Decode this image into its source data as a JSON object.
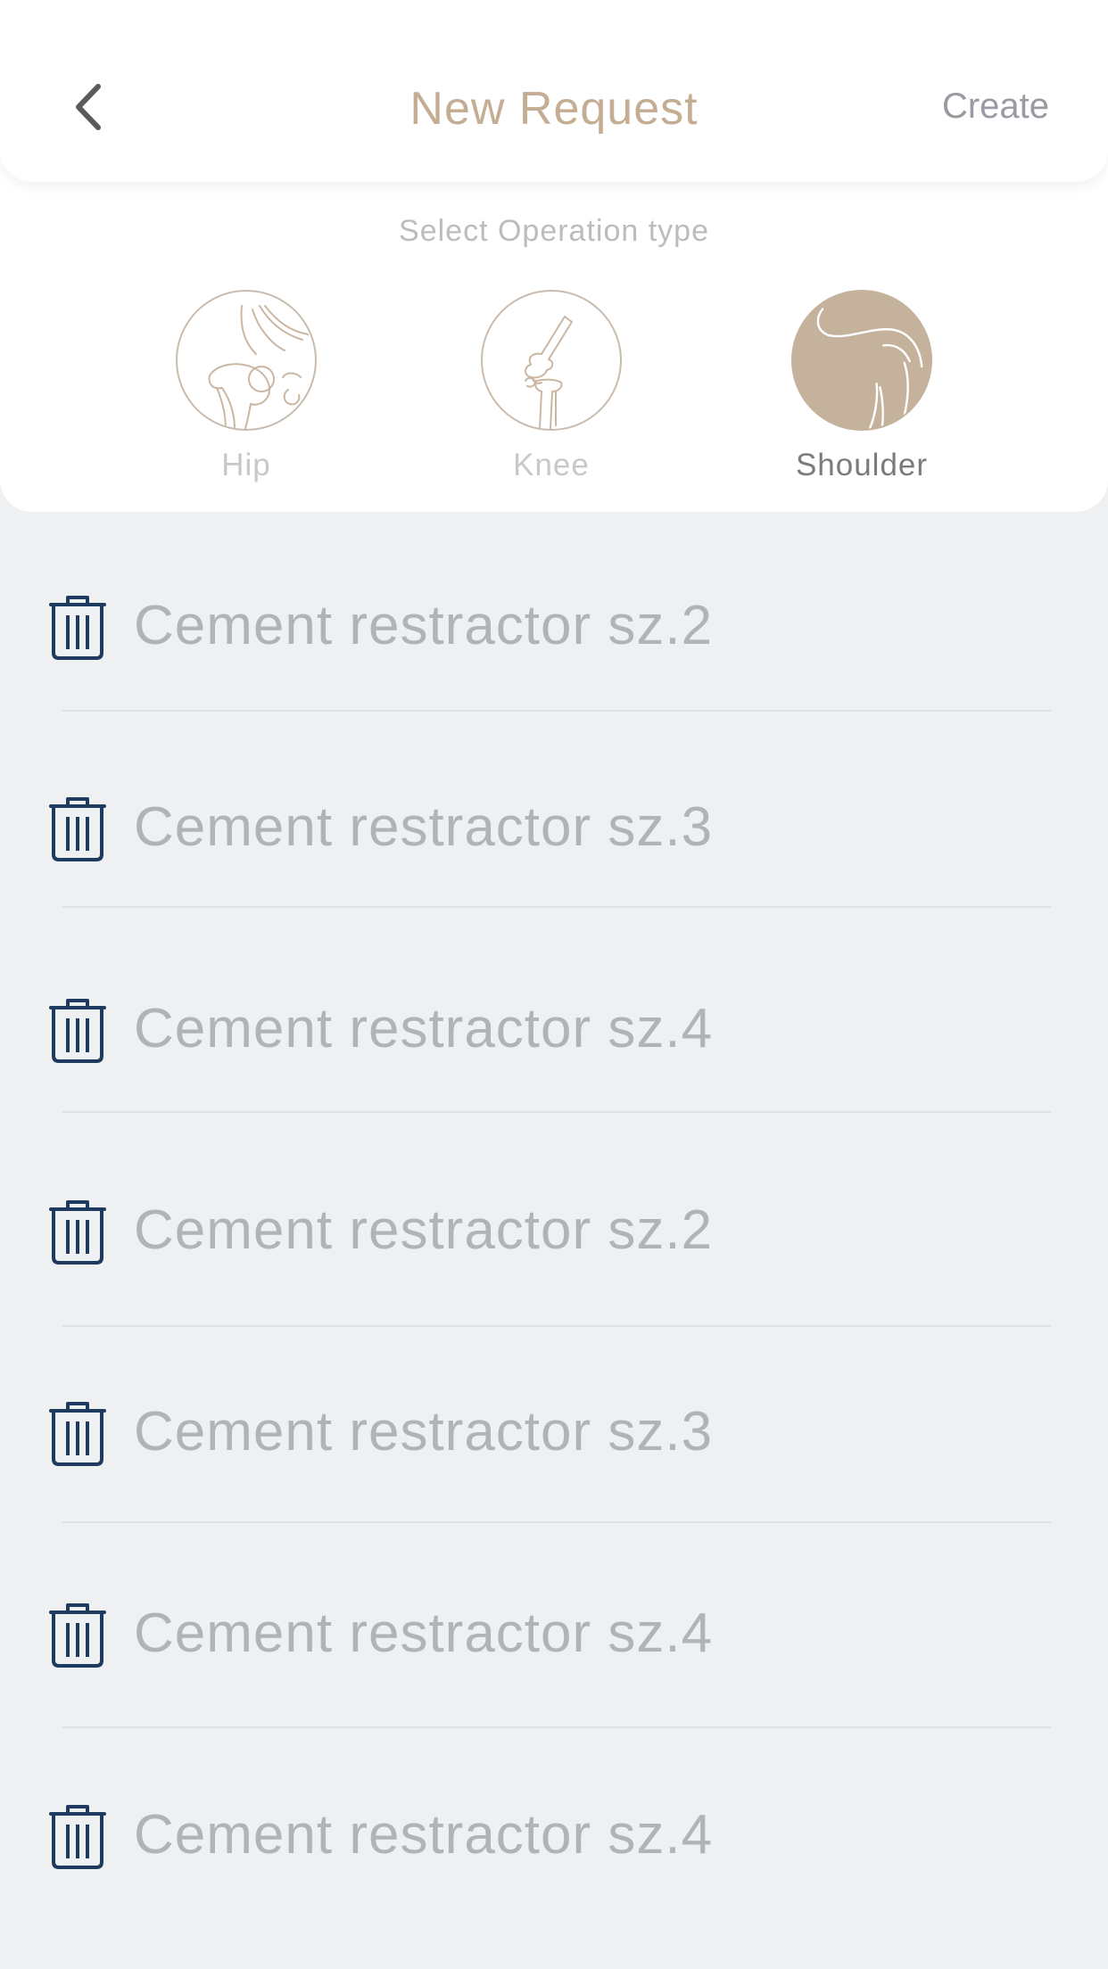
{
  "header": {
    "title": "New Request",
    "create_label": "Create",
    "back_icon": "chevron-left-icon"
  },
  "operation": {
    "heading": "Select Operation type",
    "options": [
      {
        "label": "Hip",
        "icon": "hip-joint-icon",
        "selected": false
      },
      {
        "label": "Knee",
        "icon": "knee-joint-icon",
        "selected": false
      },
      {
        "label": "Shoulder",
        "icon": "shoulder-icon",
        "selected": true
      }
    ]
  },
  "items": [
    {
      "label": "Cement restractor sz.2",
      "icon": "trash-icon"
    },
    {
      "label": "Cement restractor sz.3",
      "icon": "trash-icon"
    },
    {
      "label": "Cement restractor sz.4",
      "icon": "trash-icon"
    },
    {
      "label": "Cement restractor sz.2",
      "icon": "trash-icon"
    },
    {
      "label": "Cement restractor sz.3",
      "icon": "trash-icon"
    },
    {
      "label": "Cement restractor sz.4",
      "icon": "trash-icon"
    },
    {
      "label": "Cement restractor sz.4",
      "icon": "trash-icon"
    }
  ],
  "colors": {
    "accent": "#c4ad93",
    "selected_fill": "#c5b29c",
    "icon_navy": "#1e3a5f",
    "background": "#eef0f2"
  }
}
